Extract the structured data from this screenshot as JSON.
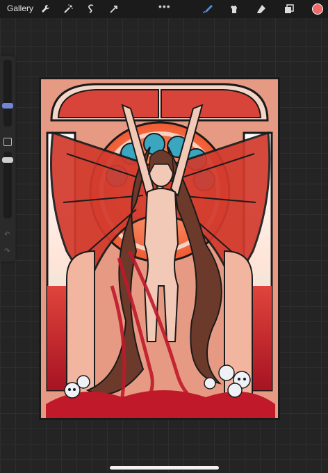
{
  "app": {
    "gallery_label": "Gallery",
    "more_menu": "•••"
  },
  "toolbar": {
    "left_tools": [
      "wrench-icon",
      "magic-wand-icon",
      "selection-icon",
      "transform-icon"
    ],
    "right_tools": [
      "brush-icon",
      "smudge-icon",
      "eraser-icon",
      "layers-icon"
    ],
    "active_tool": "brush-icon",
    "accent_color": "#4a90e2",
    "current_color": "#f06a6a"
  },
  "sidebar": {
    "brush_size_level": 0.25,
    "opacity_level": 0.9,
    "undo_icon": "undo-icon",
    "redo_icon": "redo-icon",
    "undo_glyph": "↶",
    "redo_glyph": "↷"
  },
  "artwork": {
    "palette": {
      "background": "#e69a83",
      "wing": "#d23a2d",
      "halo": "#3aa6bf",
      "blood": "#c0192a",
      "skin": "#f2c9b6",
      "hair": "#6b3a2a",
      "glass": "#bfeee6"
    }
  }
}
